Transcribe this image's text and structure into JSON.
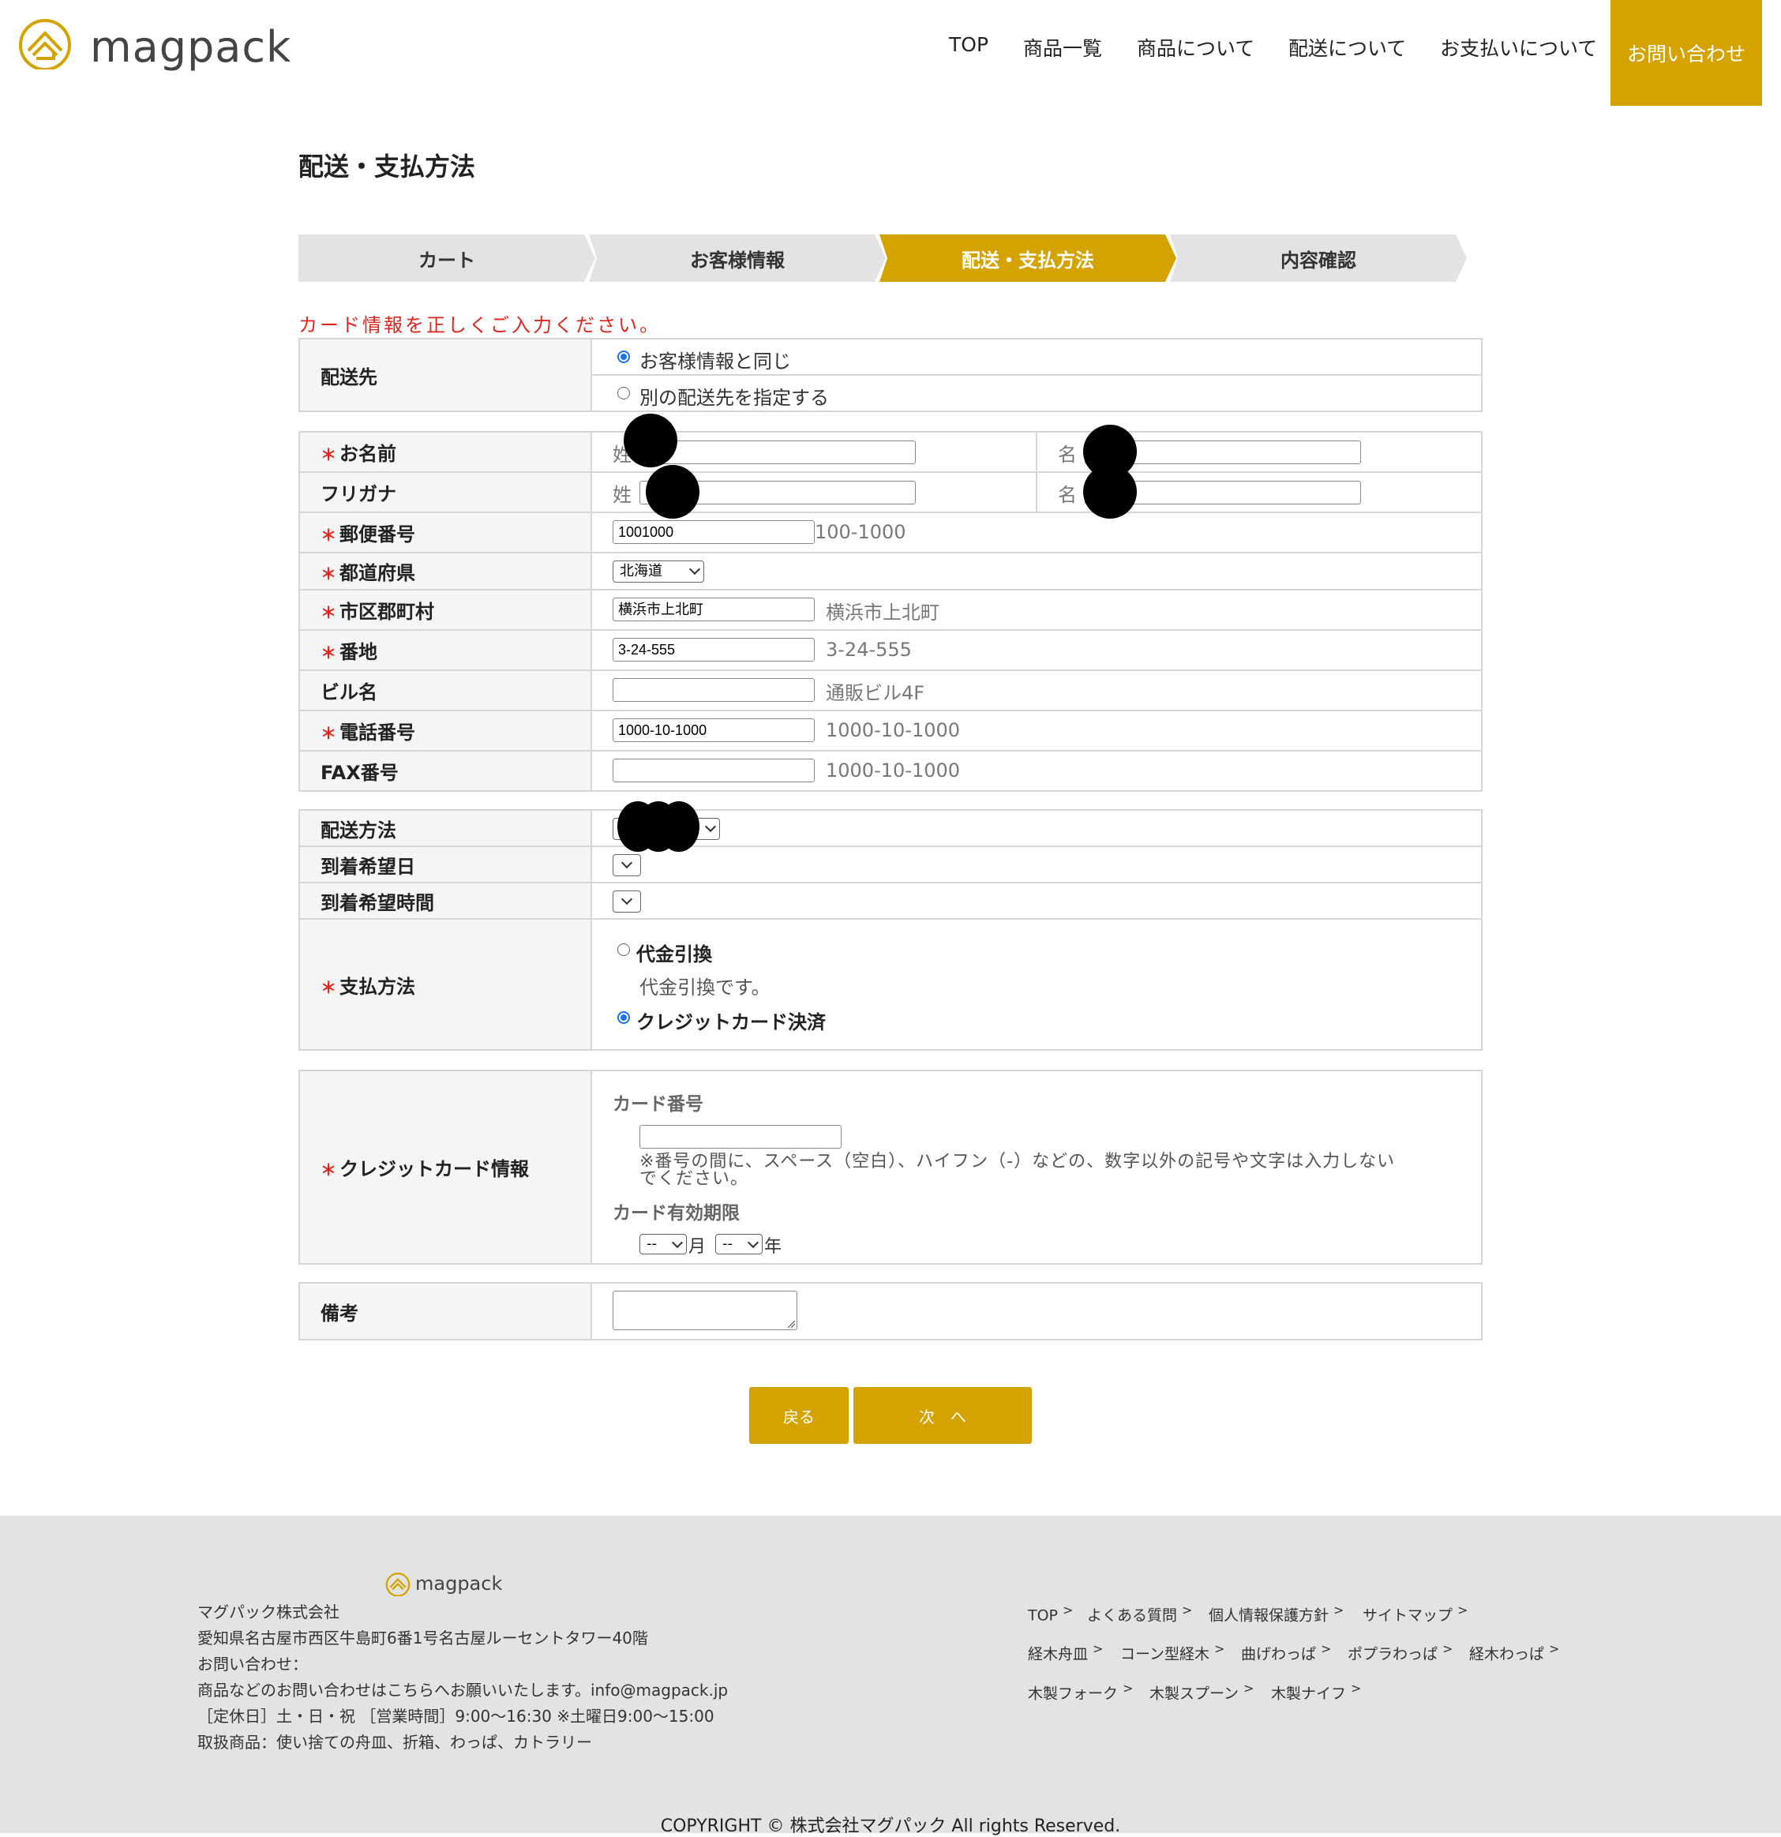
{
  "header": {
    "logo_text": "magpack",
    "nav": [
      "TOP",
      "商品一覧",
      "商品について",
      "配送について",
      "お支払いについて"
    ],
    "contact": "お問い合わせ"
  },
  "page_title": "配送・支払方法",
  "steps": [
    "カート",
    "お客様情報",
    "配送・支払方法",
    "内容確認"
  ],
  "active_step": "配送・支払方法",
  "error_message": "カード情報を正しくご入力ください。",
  "destination": {
    "label": "配送先",
    "options": [
      "お客様情報と同じ",
      "別の配送先を指定する"
    ],
    "selected": "お客様情報と同じ"
  },
  "address": {
    "required_mark": "＊",
    "name_label": "お名前",
    "kana_label": "フリガナ",
    "last_label": "姓",
    "first_label": "名",
    "zip_label": "郵便番号",
    "zip_value": "1001000",
    "zip_hint": "100-1000",
    "pref_label": "都道府県",
    "pref_value": "北海道",
    "city_label": "市区郡町村",
    "city_value": "横浜市上北町",
    "city_hint": "横浜市上北町",
    "street_label": "番地",
    "street_value": "3-24-555",
    "street_hint": "3-24-555",
    "building_label": "ビル名",
    "building_value": "",
    "building_hint": "通販ビル4F",
    "tel_label": "電話番号",
    "tel_value": "1000-10-1000",
    "tel_hint": "1000-10-1000",
    "fax_label": "FAX番号",
    "fax_value": "",
    "fax_hint": "1000-10-1000"
  },
  "delivery": {
    "method_label": "配送方法",
    "date_label": "到着希望日",
    "time_label": "到着希望時間",
    "payment_label": "支払方法",
    "payment_options": [
      {
        "label": "代金引換",
        "desc": "代金引換です。"
      },
      {
        "label": "クレジットカード決済",
        "desc": ""
      }
    ],
    "payment_selected": "クレジットカード決済"
  },
  "card": {
    "label": "クレジットカード情報",
    "number_label": "カード番号",
    "number_value": "",
    "note_line1": "※番号の間に、スペース（空白）、ハイフン（-）などの、数字以外の記号や文字は入力しない",
    "note_line2": "でください。",
    "expiry_label": "カード有効期限",
    "month_value": "--",
    "month_unit": "月",
    "year_value": "--",
    "year_unit": "年"
  },
  "remarks": {
    "label": "備考",
    "value": ""
  },
  "buttons": {
    "back": "戻る",
    "next": "次　へ"
  },
  "footer": {
    "logo_text": "magpack",
    "lines": [
      "マグパック株式会社",
      "愛知県名古屋市西区牛島町6番1号名古屋ルーセントタワー40階",
      "お問い合わせ：",
      "商品などのお問い合わせはこちらへお願いいたします。info@magpack.jp",
      "［定休日］土・日・祝 ［営業時間］9:00〜16:30 ※土曜日9:00〜15:00",
      "取扱商品：使い捨ての舟皿、折箱、わっぱ、カトラリー"
    ],
    "link_rows": [
      [
        "TOP",
        "よくある質問",
        "個人情報保護方針",
        "サイトマップ"
      ],
      [
        "経木舟皿",
        "コーン型経木",
        "曲げわっぱ",
        "ポプラわっぱ",
        "経木わっぱ"
      ],
      [
        "木製フォーク",
        "木製スプーン",
        "木製ナイフ"
      ]
    ],
    "link_arrow": ">",
    "copyright": "COPYRIGHT © 株式会社マグパック All rights Reserved."
  },
  "colors": {
    "accent": "#d4a300",
    "error": "#e0251d",
    "step_inactive": "#e3e3e3",
    "footer_bg": "#e3e3e3"
  }
}
